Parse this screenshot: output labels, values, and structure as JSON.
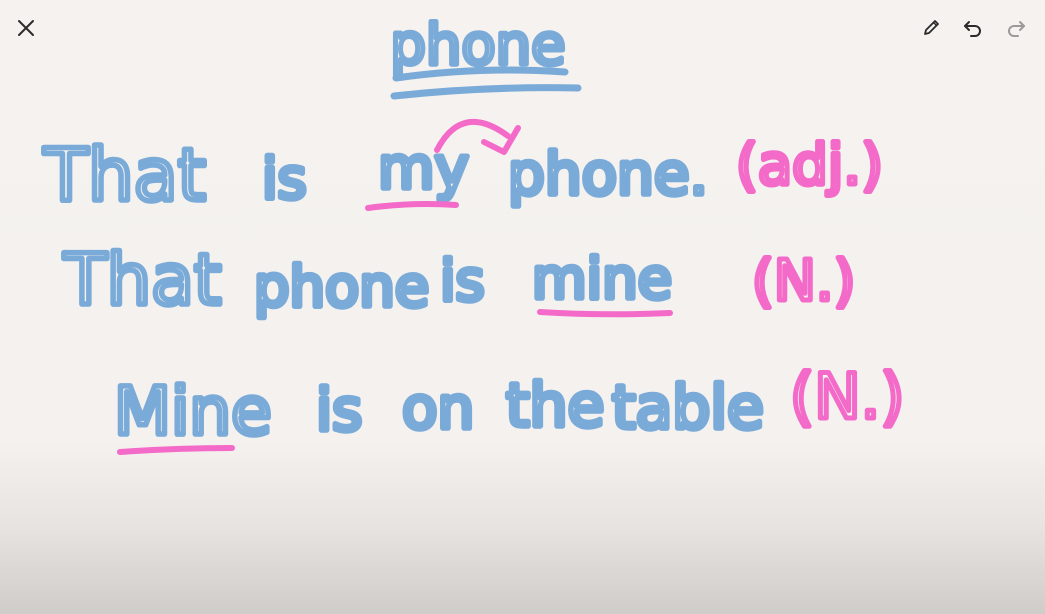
{
  "toolbar": {
    "close_icon": "close-icon",
    "pen_icon": "pencil-icon",
    "undo_icon": "undo-icon",
    "redo_icon": "redo-icon"
  },
  "colors": {
    "background": "#f4f1ee",
    "blue_ink": "#7aaad8",
    "pink_ink": "#f36ac8",
    "icon": "#2b2b2b",
    "icon_disabled": "#9a9a9a"
  },
  "note": {
    "title": "phone",
    "line1": {
      "w1": "That",
      "w2": "is",
      "w3": "my",
      "w4": "phone.",
      "tag": "(adj.)"
    },
    "line2": {
      "w1": "That",
      "w2": "phone",
      "w3": "is",
      "w4": "mine",
      "tag": "(N.)"
    },
    "line3": {
      "w1": "Mine",
      "w2": "is",
      "w3": "on",
      "w4": "the",
      "w5": "table",
      "tag": "(N.)"
    }
  }
}
